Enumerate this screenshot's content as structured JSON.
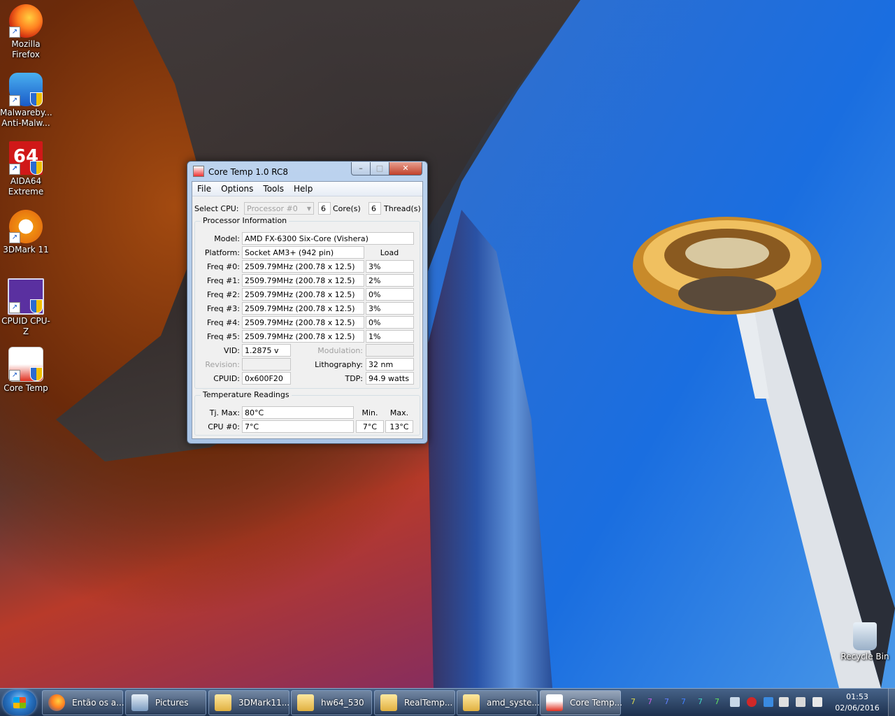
{
  "desktop": {
    "icons": [
      {
        "label": "Mozilla Firefox",
        "icon": "firefox-icon"
      },
      {
        "label": "Malwareby... Anti-Malw...",
        "icon": "malwarebytes-icon"
      },
      {
        "label": "AIDA64 Extreme",
        "icon": "aida64-icon",
        "glyph": "64"
      },
      {
        "label": "3DMark 11",
        "icon": "3dmark-icon"
      },
      {
        "label": "CPUID CPU-Z",
        "icon": "cpuz-icon"
      },
      {
        "label": "Core Temp",
        "icon": "coretemp-icon"
      }
    ],
    "recycle_bin": "Recycle Bin"
  },
  "window": {
    "title": "Core Temp 1.0 RC8",
    "min_glyph": "–",
    "max_glyph": "□",
    "close_glyph": "✕",
    "menu": [
      "File",
      "Options",
      "Tools",
      "Help"
    ],
    "select_cpu_label": "Select CPU:",
    "select_cpu_value": "Processor #0",
    "cores_value": "6",
    "cores_label": "Core(s)",
    "threads_value": "6",
    "threads_label": "Thread(s)",
    "processor_info_title": "Processor Information",
    "model_label": "Model:",
    "model_value": "AMD FX-6300 Six-Core (Vishera)",
    "platform_label": "Platform:",
    "platform_value": "Socket AM3+ (942 pin)",
    "load_header": "Load",
    "freqs": [
      {
        "label": "Freq #0:",
        "value": "2509.79MHz (200.78 x 12.5)",
        "load": "3%"
      },
      {
        "label": "Freq #1:",
        "value": "2509.79MHz (200.78 x 12.5)",
        "load": "2%"
      },
      {
        "label": "Freq #2:",
        "value": "2509.79MHz (200.78 x 12.5)",
        "load": "0%"
      },
      {
        "label": "Freq #3:",
        "value": "2509.79MHz (200.78 x 12.5)",
        "load": "3%"
      },
      {
        "label": "Freq #4:",
        "value": "2509.79MHz (200.78 x 12.5)",
        "load": "0%"
      },
      {
        "label": "Freq #5:",
        "value": "2509.79MHz (200.78 x 12.5)",
        "load": "1%"
      }
    ],
    "vid_label": "VID:",
    "vid_value": "1.2875 v",
    "modulation_label": "Modulation:",
    "modulation_value": "",
    "revision_label": "Revision:",
    "revision_value": "",
    "lithography_label": "Lithography:",
    "lithography_value": "32 nm",
    "cpuid_label": "CPUID:",
    "cpuid_value": "0x600F20",
    "tdp_label": "TDP:",
    "tdp_value": "94.9 watts",
    "temp_title": "Temperature Readings",
    "tjmax_label": "Tj. Max:",
    "tjmax_value": "80°C",
    "min_header": "Min.",
    "max_header": "Max.",
    "cpu0_label": "CPU #0:",
    "cpu0_value": "7°C",
    "cpu0_min": "7°C",
    "cpu0_max": "13°C"
  },
  "taskbar": {
    "buttons": [
      {
        "label": "Então os a...",
        "icon": "firefox-icon"
      },
      {
        "label": "Pictures",
        "icon": "pictures-icon"
      },
      {
        "label": "3DMark11...",
        "icon": "folder-icon"
      },
      {
        "label": "hw64_530",
        "icon": "folder-icon"
      },
      {
        "label": "RealTemp...",
        "icon": "folder-icon"
      },
      {
        "label": "amd_syste...",
        "icon": "folder-icon"
      },
      {
        "label": "Core Temp...",
        "icon": "coretemp-icon"
      }
    ],
    "tray_numbers": [
      "7",
      "7",
      "7",
      "7",
      "7",
      "7"
    ],
    "tray_colors": [
      "#d8d850",
      "#c060e0",
      "#6080ff",
      "#4080ff",
      "#40d0c0",
      "#60e060"
    ],
    "time": "01:53",
    "date": "02/06/2016"
  }
}
